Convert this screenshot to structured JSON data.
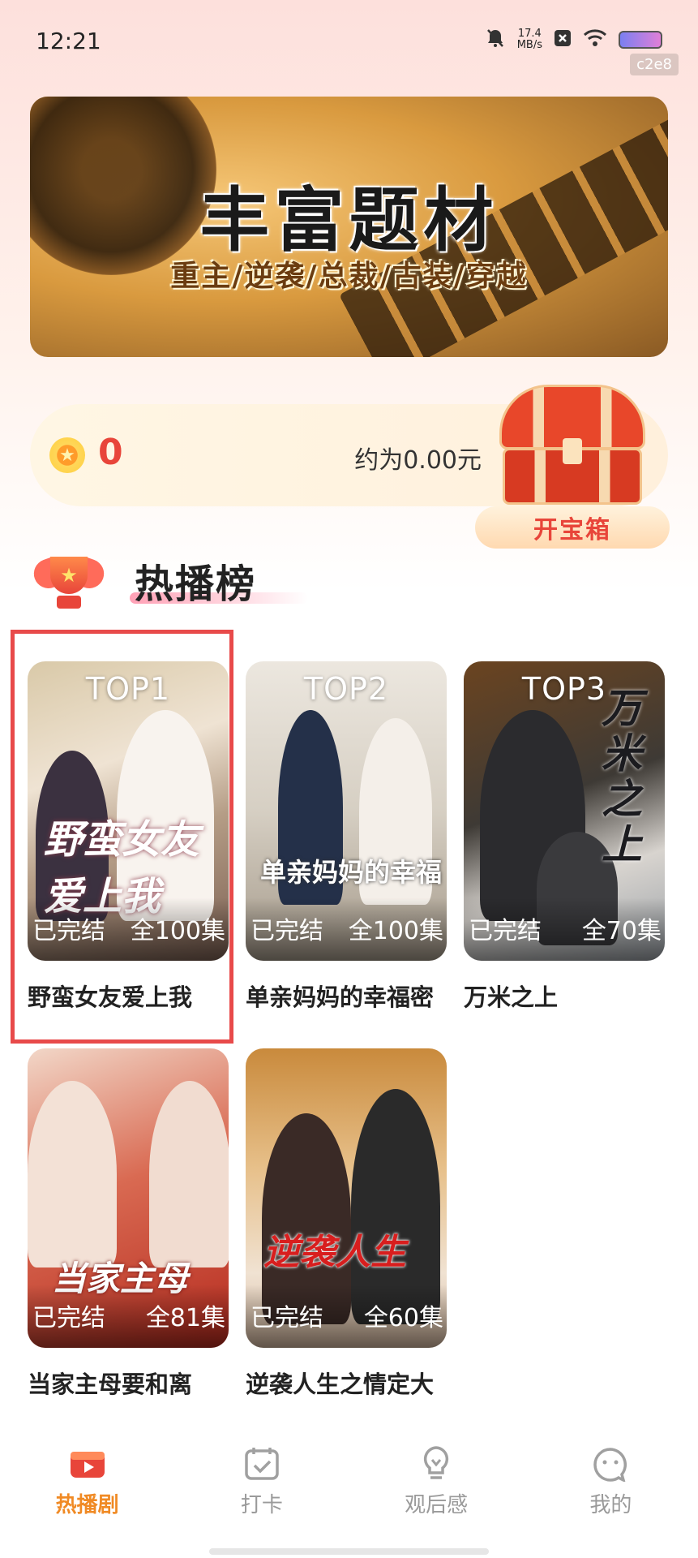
{
  "status_bar": {
    "time": "12:21",
    "net_speed_value": "17.4",
    "net_speed_unit": "MB/s",
    "badge": "c2e8"
  },
  "banner": {
    "title": "丰富题材",
    "subtitle": "重主/逆袭/总裁/古装/穿越"
  },
  "coins": {
    "count": "0",
    "approx": "约为0.00元",
    "open_chest_label": "开宝箱"
  },
  "section": {
    "title": "热播榜"
  },
  "dramas": [
    {
      "rank_label": "TOP1",
      "status": "已完结",
      "episodes": "全100集",
      "title": "野蛮女友爱上我",
      "poster_text": "野蛮女友爱上我"
    },
    {
      "rank_label": "TOP2",
      "status": "已完结",
      "episodes": "全100集",
      "title": "单亲妈妈的幸福密",
      "poster_text": "单亲妈妈的幸福"
    },
    {
      "rank_label": "TOP3",
      "status": "已完结",
      "episodes": "全70集",
      "title": "万米之上",
      "poster_text": "万米之上"
    },
    {
      "rank_label": "",
      "status": "已完结",
      "episodes": "全81集",
      "title": "当家主母要和离",
      "poster_text": "当家主母"
    },
    {
      "rank_label": "",
      "status": "已完结",
      "episodes": "全60集",
      "title": "逆袭人生之情定大",
      "poster_text": "逆袭人生"
    }
  ],
  "nav": [
    {
      "label": "热播剧",
      "icon": "video-icon",
      "active": true
    },
    {
      "label": "打卡",
      "icon": "calendar-check-icon",
      "active": false
    },
    {
      "label": "观后感",
      "icon": "lightbulb-icon",
      "active": false
    },
    {
      "label": "我的",
      "icon": "smiley-icon",
      "active": false
    }
  ],
  "colors": {
    "accent_red": "#e8453a",
    "accent_orange": "#f08a24",
    "highlight_border": "#e84a4a"
  }
}
